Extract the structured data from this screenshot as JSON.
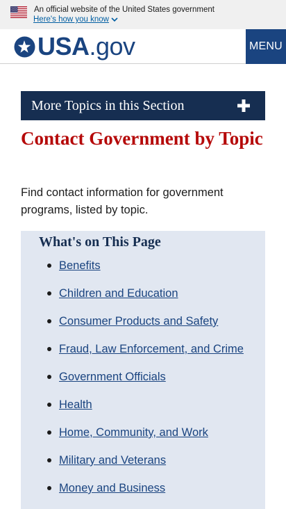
{
  "gov_banner": {
    "official_text": "An official website of the United States government",
    "how_you_know": "Here's how you know"
  },
  "header": {
    "logo_main": "USA",
    "logo_suffix": ".gov",
    "menu_label": "MENU"
  },
  "more_topics": {
    "label": "More Topics in this Section"
  },
  "page": {
    "title": "Contact Government by Topic",
    "intro": "Find contact information for government programs, listed by topic."
  },
  "toc": {
    "title": "What's on This Page",
    "items": [
      "Benefits",
      "Children and Education",
      "Consumer Products and Safety",
      "Fraud, Law Enforcement, and Crime",
      "Government Officials",
      "Health",
      "Home, Community, and Work",
      "Military and Veterans",
      "Money and Business"
    ]
  },
  "colors": {
    "banner_bg": "#f0f0f0",
    "brand_blue": "#1a4480",
    "accordion_bg": "#162e51",
    "title_red": "#b50909",
    "toc_bg": "#e1e7f1"
  }
}
